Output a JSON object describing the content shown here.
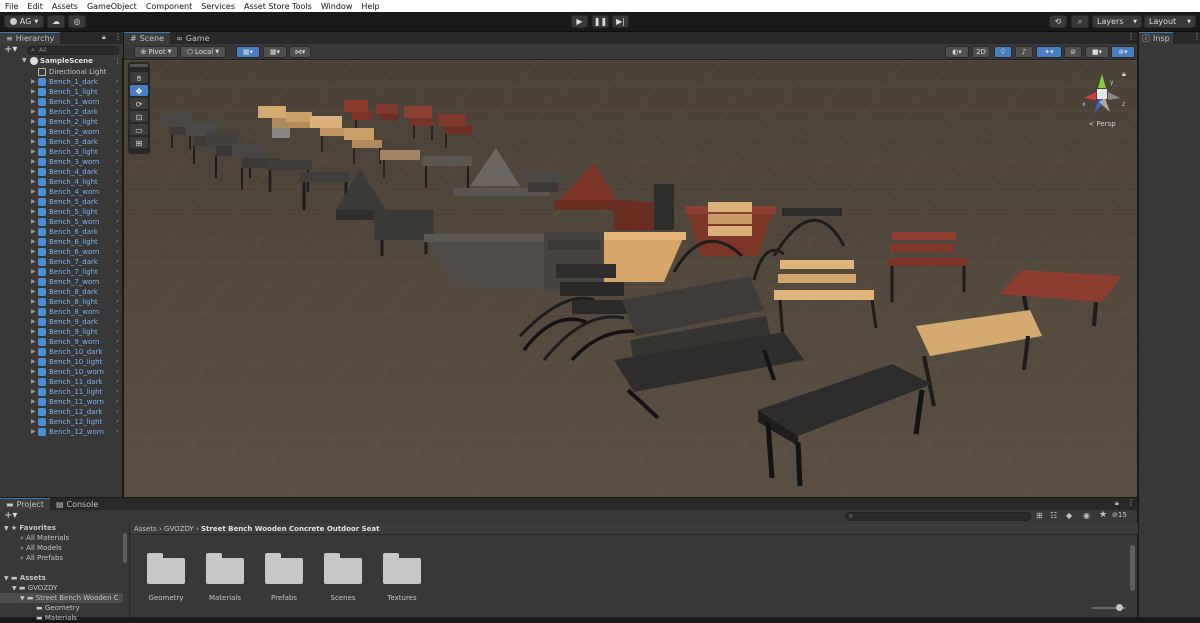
{
  "menu": [
    "File",
    "Edit",
    "Assets",
    "GameObject",
    "Component",
    "Services",
    "Asset Store Tools",
    "Window",
    "Help"
  ],
  "toolbar": {
    "account": "AG",
    "layers": "Layers",
    "layout": "Layout"
  },
  "hierarchy": {
    "tab": "Hierarchy",
    "search_placeholder": "All",
    "scene": "SampleScene",
    "items": [
      "Directional Light",
      "Bench_1_dark",
      "Bench_1_light",
      "Bench_1_worn",
      "Bench_2_dark",
      "Bench_2_light",
      "Bench_2_worn",
      "Bench_3_dark",
      "Bench_3_light",
      "Bench_3_worn",
      "Bench_4_dark",
      "Bench_4_light",
      "Bench_4_worn",
      "Bench_5_dark",
      "Bench_5_light",
      "Bench_5_worn",
      "Bench_6_dark",
      "Bench_6_light",
      "Bench_6_worn",
      "Bench_7_dark",
      "Bench_7_light",
      "Bench_7_worn",
      "Bench_8_dark",
      "Bench_8_light",
      "Bench_8_worn",
      "Bench_9_dark",
      "Bench_9_light",
      "Bench_9_worn",
      "Bench_10_dark",
      "Bench_10_light",
      "Bench_10_worn",
      "Bench_11_dark",
      "Bench_11_light",
      "Bench_11_worn",
      "Bench_12_dark",
      "Bench_12_light",
      "Bench_12_worn"
    ]
  },
  "scene": {
    "tabs": [
      "Scene",
      "Game"
    ],
    "pivot": "Pivot",
    "local": "Local",
    "mode_2d": "2D",
    "persp": "< Persp",
    "gizmo": {
      "x": "x",
      "y": "y",
      "z": "z"
    }
  },
  "inspector": {
    "tab": "Insp"
  },
  "project": {
    "tabs": [
      "Project",
      "Console"
    ],
    "favorites": {
      "title": "Favorites",
      "items": [
        "All Materials",
        "All Models",
        "All Prefabs"
      ]
    },
    "assets": {
      "title": "Assets",
      "items": [
        "GVOZDY",
        "Street Bench Wooden C",
        "Geometry",
        "Materials"
      ]
    },
    "breadcrumb": [
      "Assets",
      "GVOZDY",
      "Street Bench Wooden Concrete Outdoor Seat"
    ],
    "folders": [
      "Geometry",
      "Materials",
      "Prefabs",
      "Scenes",
      "Textures"
    ],
    "count": "15"
  },
  "colors": {
    "accent": "#3a79bb",
    "ground": "#4e4539",
    "light_wood": "#c9a06a",
    "red_wood": "#7a3325",
    "dark_wood": "#383634"
  }
}
